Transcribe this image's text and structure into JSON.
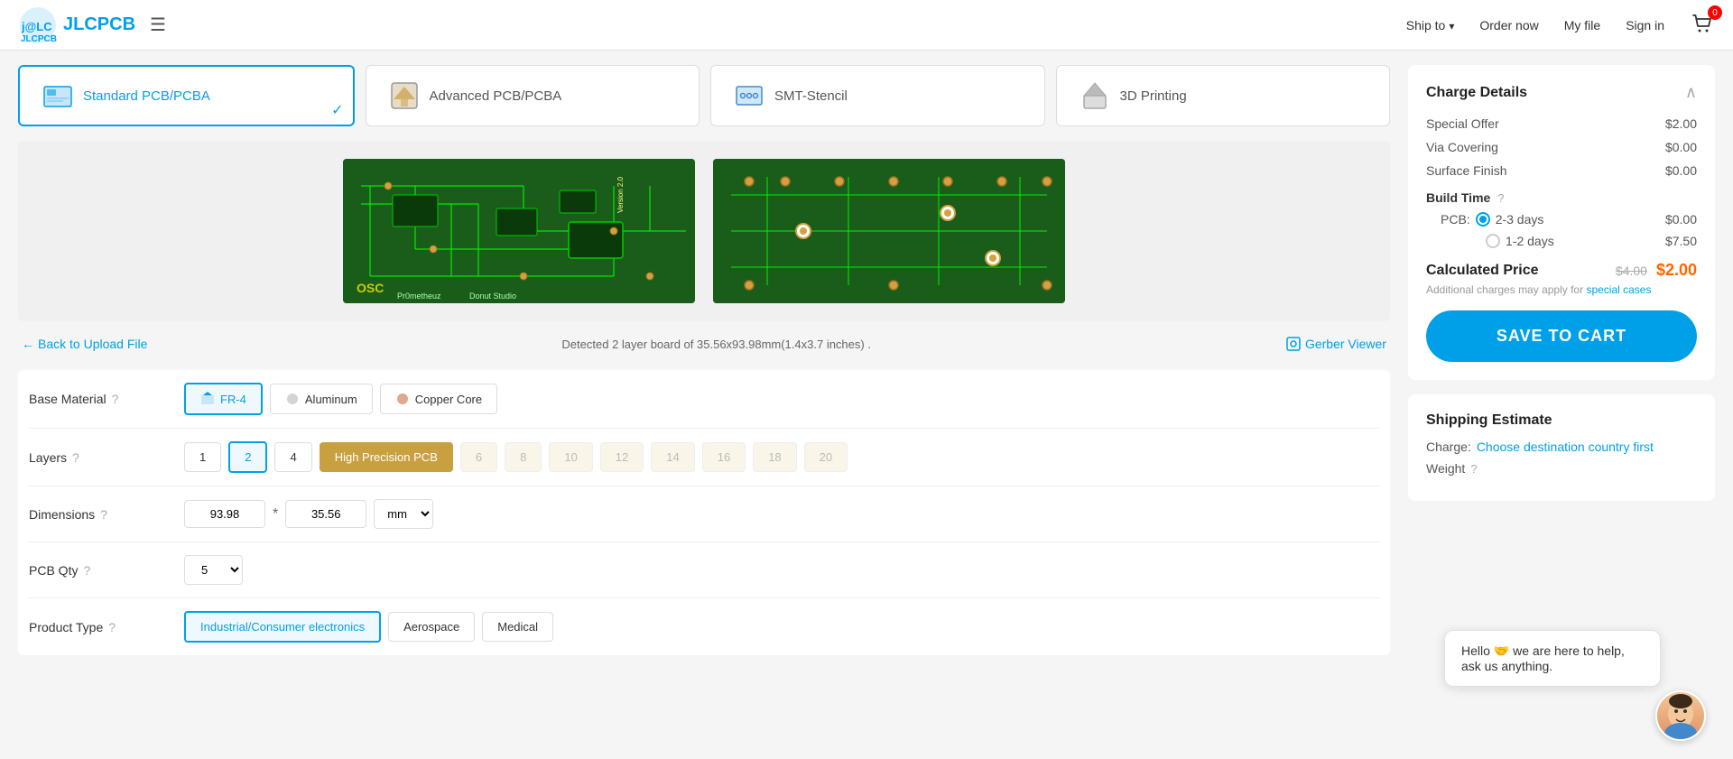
{
  "header": {
    "logo_text": "JLCPCB",
    "ship_to_label": "Ship to",
    "order_now_label": "Order now",
    "my_file_label": "My file",
    "sign_in_label": "Sign in",
    "cart_count": "0"
  },
  "tabs": [
    {
      "id": "standard",
      "label": "Standard PCB/PCBA",
      "active": true
    },
    {
      "id": "advanced",
      "label": "Advanced PCB/PCBA",
      "active": false
    },
    {
      "id": "stencil",
      "label": "SMT-Stencil",
      "active": false
    },
    {
      "id": "printing",
      "label": "3D Printing",
      "active": false
    }
  ],
  "board": {
    "detected_text": "Detected 2 layer board of 35.56x93.98mm(1.4x3.7 inches) .",
    "back_link": "Back to Upload File",
    "gerber_link": "Gerber Viewer"
  },
  "options": {
    "base_material": {
      "label": "Base Material",
      "choices": [
        "FR-4",
        "Aluminum",
        "Copper Core"
      ],
      "selected": "FR-4"
    },
    "layers": {
      "label": "Layers",
      "choices": [
        "1",
        "2",
        "4"
      ],
      "selected": "2",
      "high_precision_label": "High Precision PCB",
      "high_precision_options": [
        "6",
        "8",
        "10",
        "12",
        "14",
        "16",
        "18",
        "20"
      ]
    },
    "dimensions": {
      "label": "Dimensions",
      "val1": "93.98",
      "val2": "35.56",
      "unit": "mm"
    },
    "pcb_qty": {
      "label": "PCB Qty",
      "selected": "5"
    },
    "product_type": {
      "label": "Product Type",
      "choices": [
        "Industrial/Consumer electronics",
        "Aerospace",
        "Medical"
      ],
      "selected": "Industrial/Consumer electronics"
    }
  },
  "charge_details": {
    "title": "Charge Details",
    "rows": [
      {
        "label": "Special Offer",
        "value": "$2.00"
      },
      {
        "label": "Via Covering",
        "value": "$0.00"
      },
      {
        "label": "Surface Finish",
        "value": "$0.00"
      }
    ],
    "build_time_label": "Build Time",
    "pcb_label": "PCB:",
    "build_options": [
      {
        "label": "2-3 days",
        "price": "$0.00",
        "selected": true
      },
      {
        "label": "1-2 days",
        "price": "$7.50",
        "selected": false
      }
    ],
    "calculated_price_label": "Calculated Price",
    "price_original": "$4.00",
    "price_final": "$2.00",
    "note": "Additional charges may apply for",
    "note_link": "special cases",
    "save_to_cart": "SAVE TO CART"
  },
  "shipping": {
    "title": "Shipping Estimate",
    "charge_label": "Charge:",
    "charge_link": "Choose destination country first",
    "weight_label": "Weight"
  },
  "chat": {
    "message": "Hello 🤝 we are here to help, ask us anything."
  }
}
